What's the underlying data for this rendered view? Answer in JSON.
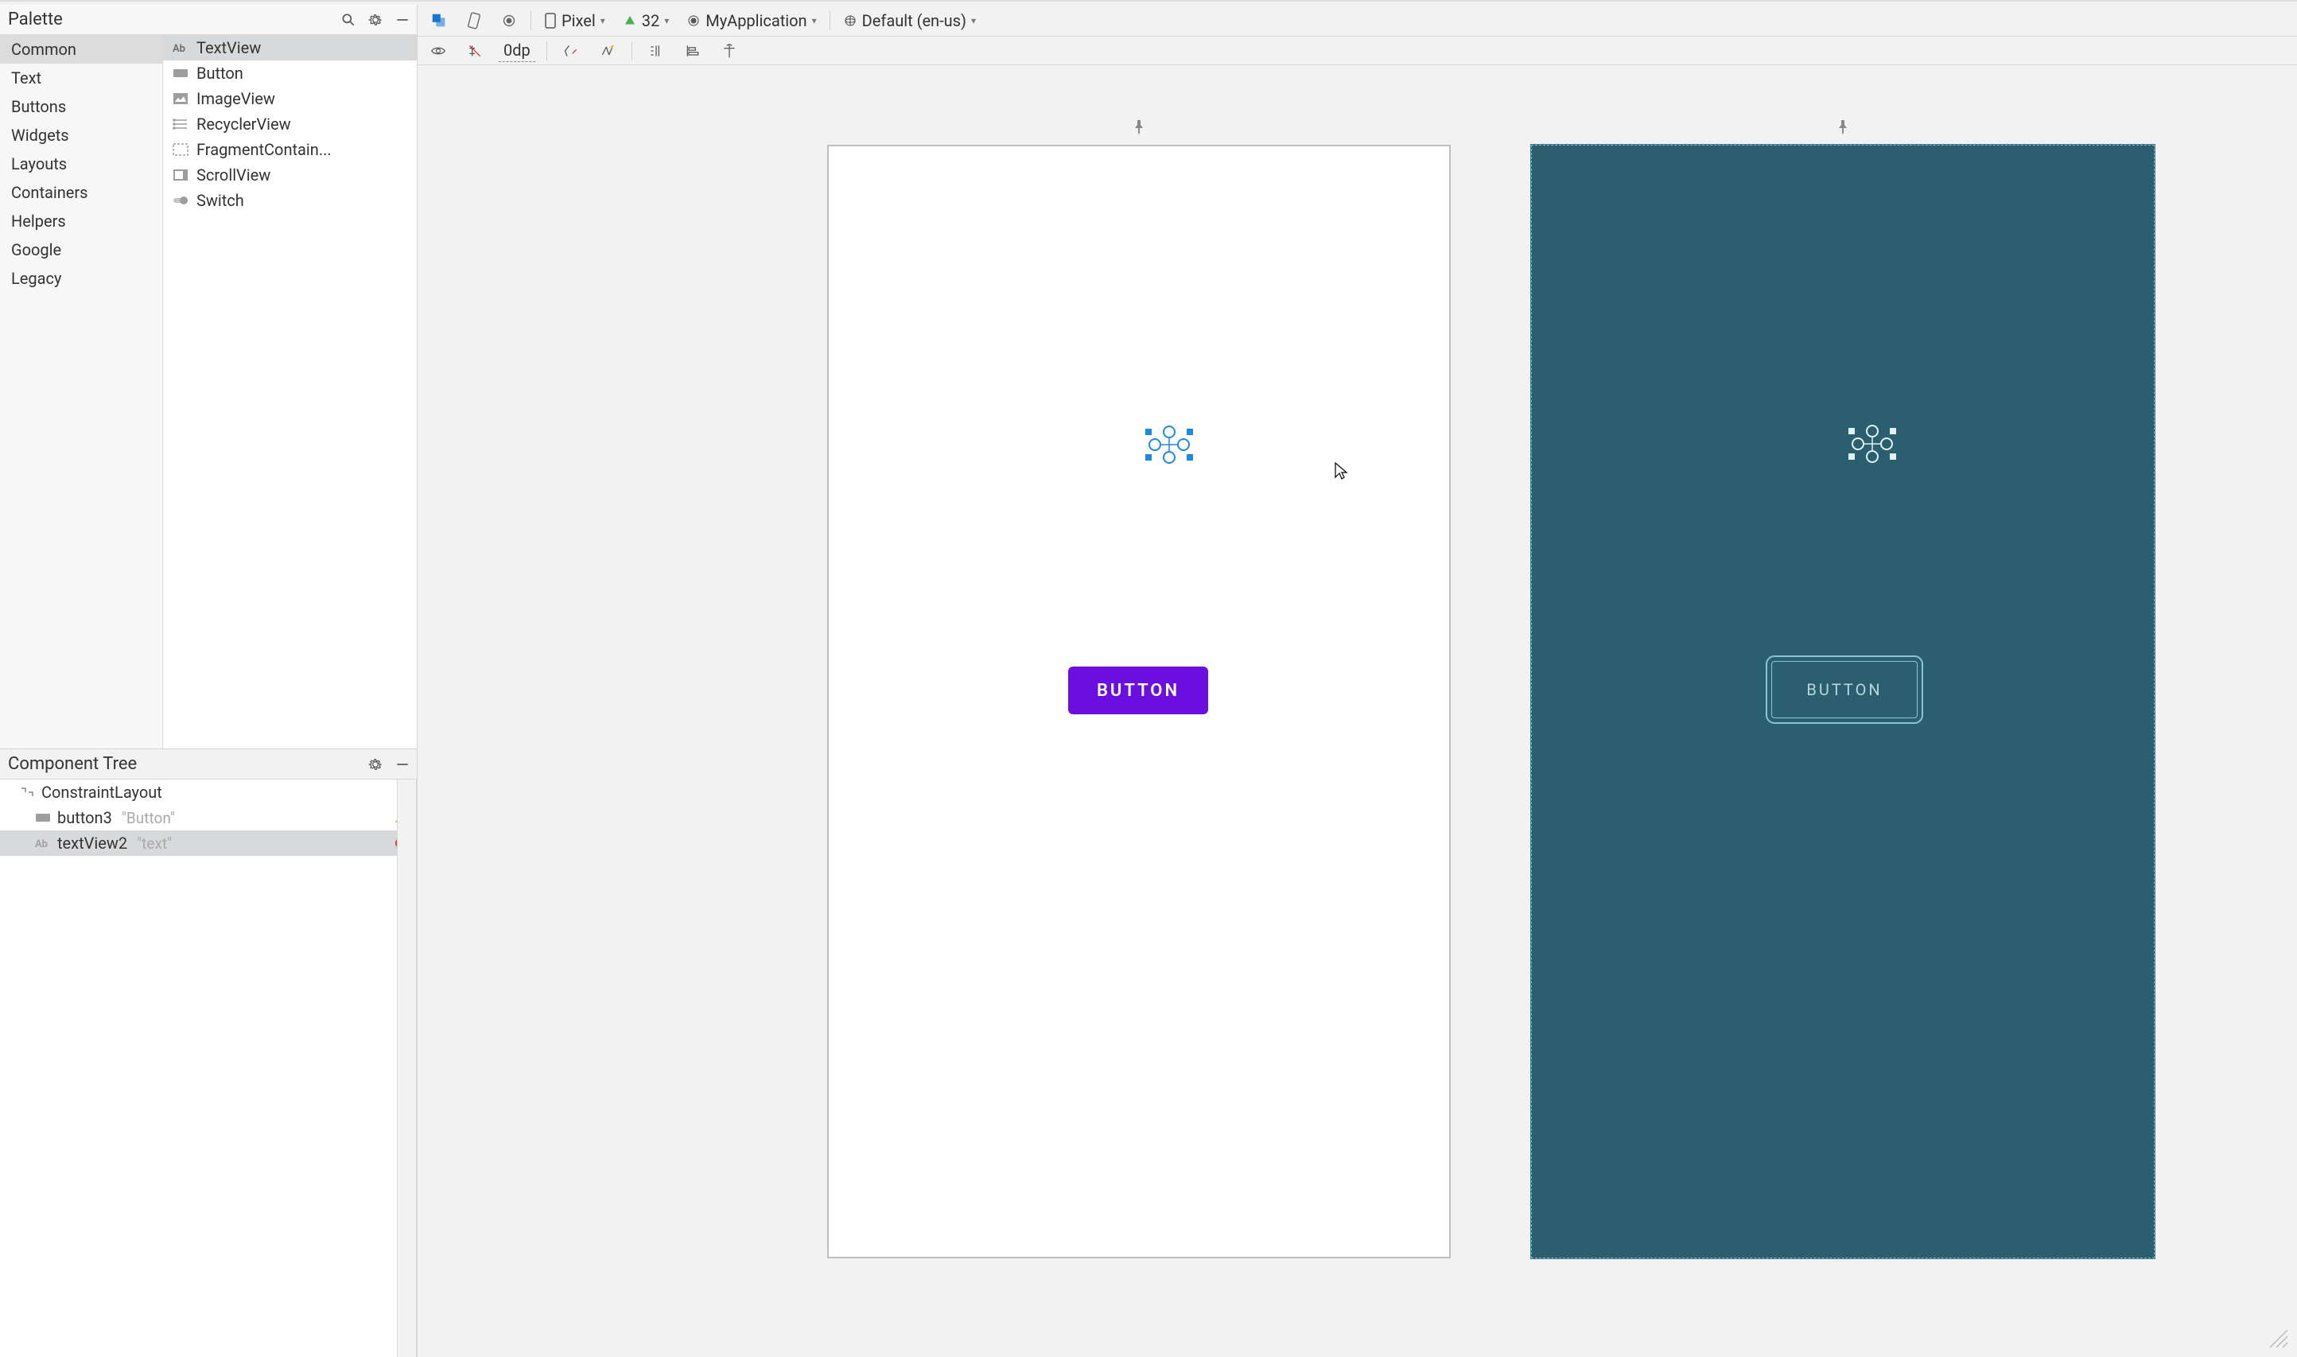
{
  "palette": {
    "title": "Palette",
    "categories": [
      "Common",
      "Text",
      "Buttons",
      "Widgets",
      "Layouts",
      "Containers",
      "Helpers",
      "Google",
      "Legacy"
    ],
    "selected_category_index": 0,
    "widgets": [
      {
        "label": "TextView",
        "icon": "textview"
      },
      {
        "label": "Button",
        "icon": "button"
      },
      {
        "label": "ImageView",
        "icon": "imageview"
      },
      {
        "label": "RecyclerView",
        "icon": "recyclerview"
      },
      {
        "label": "FragmentContain...",
        "icon": "fragment"
      },
      {
        "label": "ScrollView",
        "icon": "scrollview"
      },
      {
        "label": "Switch",
        "icon": "switch"
      }
    ],
    "selected_widget_index": 0
  },
  "component_tree": {
    "title": "Component Tree",
    "rows": [
      {
        "icon": "constraintlayout",
        "label": "ConstraintLayout",
        "secondary": "",
        "status": "",
        "indent": 1
      },
      {
        "icon": "button",
        "label": "button3",
        "secondary": "\"Button\"",
        "status": "warning",
        "indent": 2
      },
      {
        "icon": "textview",
        "label": "textView2",
        "secondary": "\"text\"",
        "status": "error",
        "indent": 2,
        "selected": true
      }
    ]
  },
  "toolbar": {
    "device": "Pixel",
    "api": "32",
    "app": "MyApplication",
    "locale": "Default (en-us)",
    "margin_label": "0dp"
  },
  "canvas": {
    "design_button_text": "BUTTON",
    "blueprint_button_text": "BUTTON"
  }
}
